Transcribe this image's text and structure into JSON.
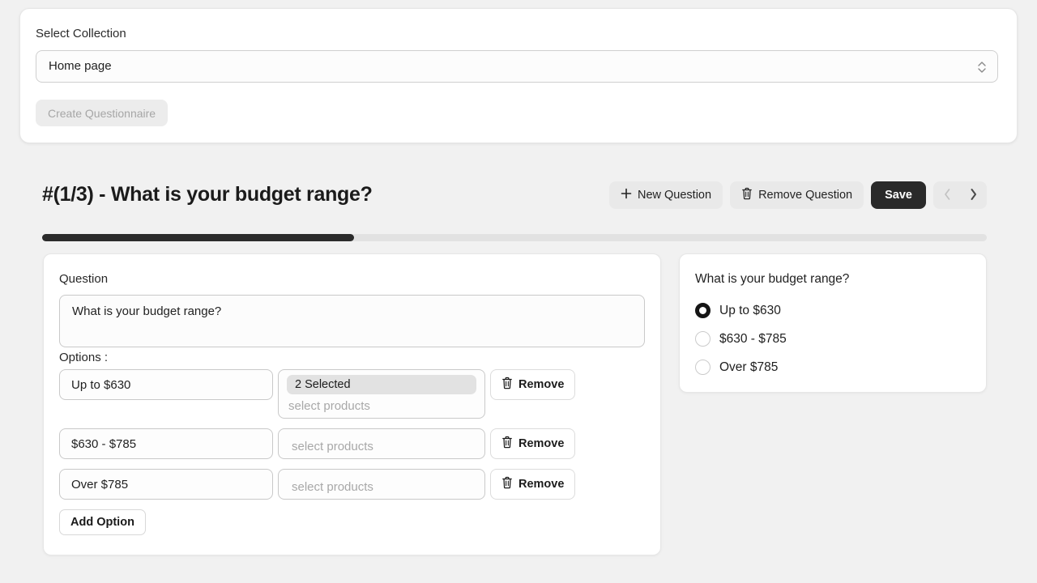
{
  "collection": {
    "label": "Select Collection",
    "selected": "Home page",
    "create_button": "Create Questionnaire",
    "chevron_icon": "chevron-up-down-icon"
  },
  "header": {
    "title": "#(1/3) - What is your budget range?",
    "new_question": "New Question",
    "remove_question": "Remove Question",
    "save": "Save",
    "plus_icon": "plus-icon",
    "trash_icon": "trash-icon",
    "prev_icon": "chevron-left-icon",
    "next_icon": "chevron-right-icon"
  },
  "progress": {
    "current": 1,
    "total": 3,
    "percent": 33
  },
  "editor": {
    "question_label": "Question",
    "question_value": "What is your budget range?",
    "options_label": "Options :",
    "add_option": "Add Option",
    "remove_label": "Remove",
    "products_placeholder": "select products",
    "options": [
      {
        "value": "Up to $630",
        "products_summary": "2 Selected",
        "products_placeholder": "select products"
      },
      {
        "value": "$630 - $785",
        "products_summary": "",
        "products_placeholder": "select products"
      },
      {
        "value": "Over $785",
        "products_summary": "",
        "products_placeholder": "select products"
      }
    ]
  },
  "preview": {
    "question": "What is your budget range?",
    "options": [
      {
        "label": "Up to $630",
        "selected": true
      },
      {
        "label": "$630 - $785",
        "selected": false
      },
      {
        "label": "Over $785",
        "selected": false
      }
    ]
  },
  "colors": {
    "page_bg": "#f1f1f1",
    "accent_dark": "#2a2a2a",
    "card_bg": "#ffffff",
    "muted_text": "#a8a8a8"
  }
}
